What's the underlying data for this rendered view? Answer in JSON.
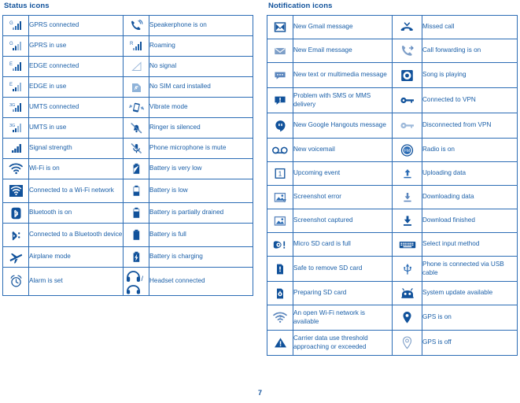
{
  "page": {
    "number": "7",
    "accent_color": "#11529b",
    "text_color": "#1a5fa8",
    "border_color": "#2b6cb5",
    "background": "#ffffff"
  },
  "status_section": {
    "title": "Status icons",
    "rows": [
      {
        "left_icon": "gprs-connected-icon",
        "left_label": "GPRS connected",
        "right_icon": "speakerphone-icon",
        "right_label": "Speakerphone is on"
      },
      {
        "left_icon": "gprs-in-use-icon",
        "left_label": "GPRS in use",
        "right_icon": "roaming-icon",
        "right_label": "Roaming"
      },
      {
        "left_icon": "edge-connected-icon",
        "left_label": "EDGE connected",
        "right_icon": "no-signal-icon",
        "right_label": "No signal"
      },
      {
        "left_icon": "edge-in-use-icon",
        "left_label": "EDGE in use",
        "right_icon": "no-sim-card-icon",
        "right_label": "No SIM card installed"
      },
      {
        "left_icon": "umts-connected-icon",
        "left_label": "UMTS connected",
        "right_icon": "vibrate-mode-icon",
        "right_label": "Vibrate mode"
      },
      {
        "left_icon": "umts-in-use-icon",
        "left_label": "UMTS in use",
        "right_icon": "ringer-silenced-icon",
        "right_label": "Ringer is silenced"
      },
      {
        "left_icon": "signal-strength-icon",
        "left_label": "Signal strength",
        "right_icon": "microphone-mute-icon",
        "right_label": "Phone microphone is mute"
      },
      {
        "left_icon": "wifi-on-icon",
        "left_label": "Wi-Fi is on",
        "right_icon": "battery-very-low-icon",
        "right_label": "Battery is very low"
      },
      {
        "left_icon": "wifi-connected-icon",
        "left_label": "Connected to a Wi-Fi network",
        "right_icon": "battery-low-icon",
        "right_label": "Battery is low"
      },
      {
        "left_icon": "bluetooth-on-icon",
        "left_label": "Bluetooth is on",
        "right_icon": "battery-partial-icon",
        "right_label": "Battery is partially drained"
      },
      {
        "left_icon": "bluetooth-connected-icon",
        "left_label": "Connected to a Bluetooth device",
        "right_icon": "battery-full-icon",
        "right_label": "Battery is full"
      },
      {
        "left_icon": "airplane-mode-icon",
        "left_label": "Airplane mode",
        "right_icon": "battery-charging-icon",
        "right_label": "Battery is charging"
      },
      {
        "left_icon": "alarm-set-icon",
        "left_label": "Alarm is set",
        "right_icon": "headset-icon",
        "right_label": "Headset connected"
      }
    ]
  },
  "notification_section": {
    "title": "Notification icons",
    "rows": [
      {
        "left_icon": "gmail-icon",
        "left_label": "New Gmail message",
        "right_icon": "missed-call-icon",
        "right_label": "Missed call"
      },
      {
        "left_icon": "email-icon",
        "left_label": "New Email message",
        "right_icon": "call-forwarding-icon",
        "right_label": "Call forwarding is on"
      },
      {
        "left_icon": "sms-mms-icon",
        "left_label": "New text or multimedia message",
        "right_icon": "music-playing-icon",
        "right_label": "Song is playing"
      },
      {
        "left_icon": "sms-problem-icon",
        "left_label": "Problem with SMS or MMS delivery",
        "right_icon": "vpn-connected-icon",
        "right_label": "Connected to VPN"
      },
      {
        "left_icon": "hangouts-icon",
        "left_label": "New Google Hangouts message",
        "right_icon": "vpn-disconnected-icon",
        "right_label": "Disconnected from VPN"
      },
      {
        "left_icon": "voicemail-icon",
        "left_label": "New voicemail",
        "right_icon": "radio-on-icon",
        "right_label": "Radio is on"
      },
      {
        "left_icon": "upcoming-event-icon",
        "left_label": "Upcoming event",
        "right_icon": "uploading-icon",
        "right_label": "Uploading data"
      },
      {
        "left_icon": "screenshot-error-icon",
        "left_label": "Screenshot error",
        "right_icon": "downloading-icon",
        "right_label": "Downloading data"
      },
      {
        "left_icon": "screenshot-captured-icon",
        "left_label": "Screenshot captured",
        "right_icon": "download-finished-icon",
        "right_label": "Download finished"
      },
      {
        "left_icon": "sd-card-full-icon",
        "left_label": "Micro SD card is full",
        "right_icon": "keyboard-icon",
        "right_label": "Select input method"
      },
      {
        "left_icon": "sd-card-safe-remove-icon",
        "left_label": "Safe to remove SD card",
        "right_icon": "usb-icon",
        "right_label": "Phone is connected via USB cable"
      },
      {
        "left_icon": "sd-card-preparing-icon",
        "left_label": "Preparing SD card",
        "right_icon": "system-update-icon",
        "right_label": "System update available"
      },
      {
        "left_icon": "open-wifi-icon",
        "left_label": "An open Wi-Fi network is available",
        "right_icon": "gps-on-icon",
        "right_label": "GPS is on"
      },
      {
        "left_icon": "data-threshold-icon",
        "left_label": "Carrier data use threshold approaching or exceeded",
        "right_icon": "gps-off-icon",
        "right_label": "GPS is off"
      }
    ]
  }
}
